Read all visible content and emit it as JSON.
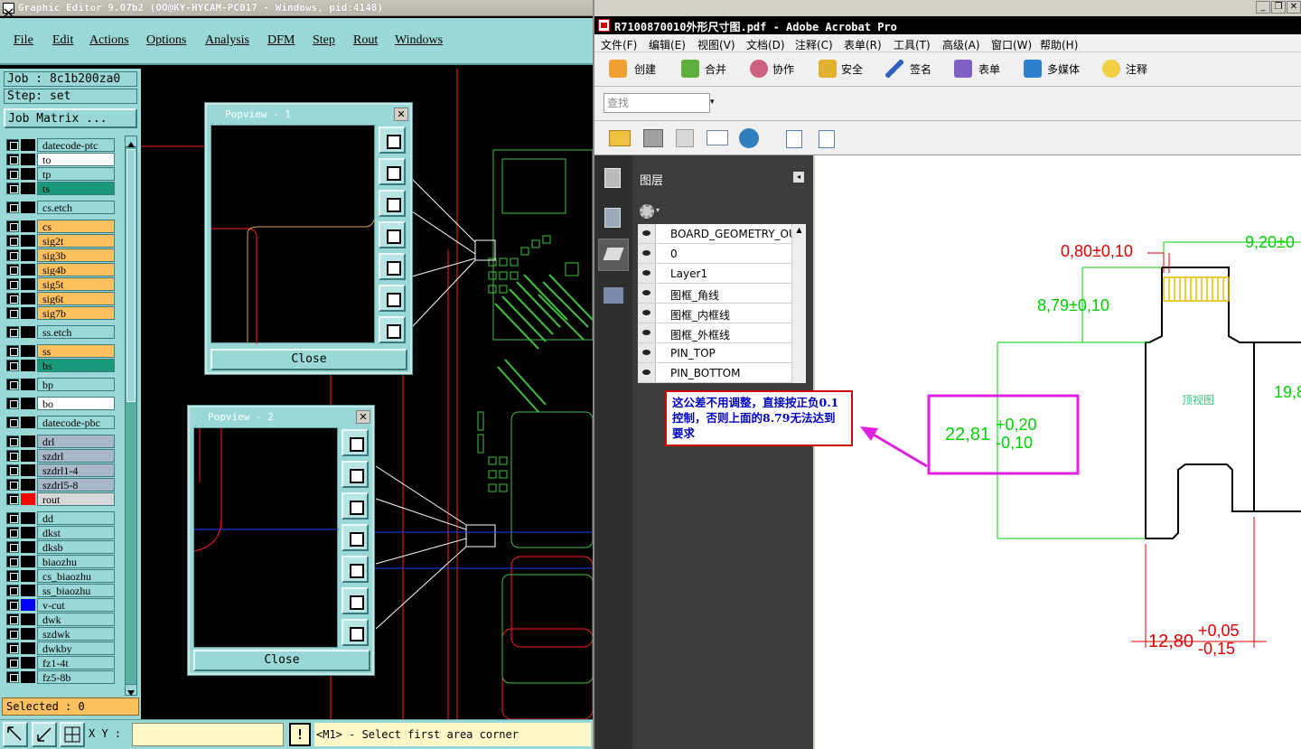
{
  "graphic_editor": {
    "title": "Graphic Editor 9.07b2 (OO@KY-HYCAM-PC017 - Windows, pid:4148)",
    "menu": [
      "File",
      "Edit",
      "Actions",
      "Options",
      "Analysis",
      "DFM",
      "Step",
      "Rout",
      "Windows"
    ],
    "job": "Job : 8c1b200za0",
    "step": "Step: set",
    "job_matrix": "Job Matrix ...",
    "layers": [
      {
        "name": "datecode-ptc",
        "color": "#9ad8d8"
      },
      {
        "name": "to",
        "color": "#ffffff"
      },
      {
        "name": "tp",
        "color": "#9ad8d8"
      },
      {
        "name": "ts",
        "color": "#1a9a7a"
      },
      {
        "name": "cs.etch",
        "color": "#9ad8d8"
      },
      {
        "name": "cs",
        "color": "#ffc060"
      },
      {
        "name": "sig2t",
        "color": "#ffc060"
      },
      {
        "name": "sig3b",
        "color": "#ffc060"
      },
      {
        "name": "sig4b",
        "color": "#ffc060"
      },
      {
        "name": "sig5t",
        "color": "#ffc060"
      },
      {
        "name": "sig6t",
        "color": "#ffc060"
      },
      {
        "name": "sig7b",
        "color": "#ffc060"
      },
      {
        "name": "ss.etch",
        "color": "#9ad8d8"
      },
      {
        "name": "ss",
        "color": "#ffc060"
      },
      {
        "name": "bs",
        "color": "#1a9a7a"
      },
      {
        "name": "bp",
        "color": "#9ad8d8"
      },
      {
        "name": "bo",
        "color": "#ffffff"
      },
      {
        "name": "datecode-pbc",
        "color": "#9ad8d8"
      },
      {
        "name": "drl",
        "color": "#a8b8c8"
      },
      {
        "name": "szdrl",
        "color": "#a8b8c8"
      },
      {
        "name": "szdrl1-4",
        "color": "#a8b8c8"
      },
      {
        "name": "szdrl5-8",
        "color": "#a8b8c8"
      },
      {
        "name": "rout",
        "color": "#d8d8d8",
        "swatch": "#ff0000"
      },
      {
        "name": "dd",
        "color": "#9ad8d8"
      },
      {
        "name": "dkst",
        "color": "#9ad8d8"
      },
      {
        "name": "dksb",
        "color": "#9ad8d8"
      },
      {
        "name": "biaozhu",
        "color": "#9ad8d8"
      },
      {
        "name": "cs_biaozhu",
        "color": "#9ad8d8"
      },
      {
        "name": "ss_biaozhu",
        "color": "#9ad8d8"
      },
      {
        "name": "v-cut",
        "color": "#9ad8d8",
        "swatch": "#0000ff"
      },
      {
        "name": "dwk",
        "color": "#9ad8d8"
      },
      {
        "name": "szdwk",
        "color": "#9ad8d8"
      },
      {
        "name": "dwkby",
        "color": "#9ad8d8"
      },
      {
        "name": "fz1-4t",
        "color": "#9ad8d8"
      },
      {
        "name": "fz5-8b",
        "color": "#9ad8d8"
      }
    ],
    "selected": "Selected : 0",
    "popview1": {
      "title": "Popview - 1",
      "close": "Close"
    },
    "popview2": {
      "title": "Popview - 2",
      "close": "Close"
    },
    "xy_label": "X Y :",
    "xy_value": "",
    "status_icon": "!",
    "status_msg": "<M1> - Select first area corner"
  },
  "acrobat": {
    "title": "R7100870010外形尺寸图.pdf - Adobe Acrobat Pro",
    "menu": [
      "文件(F)",
      "编辑(E)",
      "视图(V)",
      "文档(D)",
      "注释(C)",
      "表单(R)",
      "工具(T)",
      "高级(A)",
      "窗口(W)",
      "帮助(H)"
    ],
    "toolbar": [
      "创建",
      "合并",
      "协作",
      "安全",
      "签名",
      "表单",
      "多媒体",
      "注释"
    ],
    "find_placeholder": "查找",
    "layers_title": "图层",
    "layers": [
      "BOARD_GEOMETRY_OU",
      "0",
      "Layer1",
      "图框_角线",
      "图框_内框线",
      "图框_外框线",
      "PIN_TOP",
      "PIN_BOTTOM"
    ],
    "note": "这公差不用调整，直接按正负0.1控制，否则上面的8.79无法达到要求",
    "drawing": {
      "dim_080": "0,80±0,10",
      "dim_920": "9,20±0",
      "dim_879": "8,79±0,10",
      "dim_2281": "22,81",
      "dim_2281_plus": "+0,20",
      "dim_2281_minus": "-0,10",
      "dim_1280": "12,80",
      "dim_1280_plus": "+0,05",
      "dim_1280_minus": "-0,15",
      "dim_19": "19,8",
      "view_label": "顶视图"
    }
  }
}
